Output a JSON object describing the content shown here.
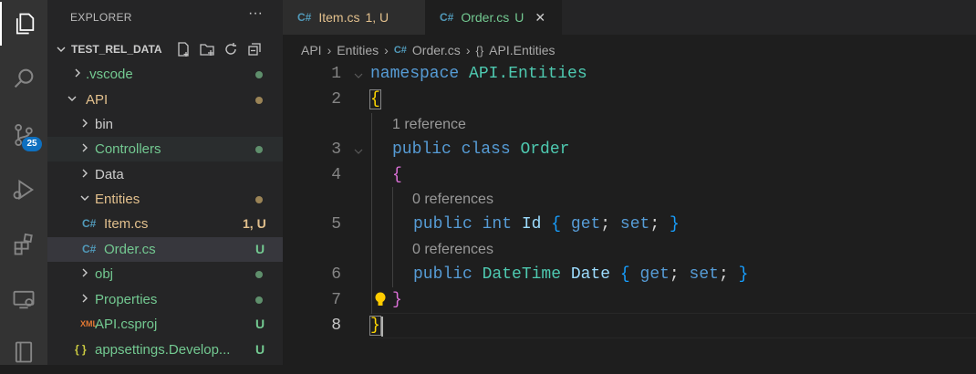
{
  "sidebar": {
    "title": "EXPLORER",
    "more": "···",
    "root": "TEST_REL_DATA",
    "items": [
      {
        "label": ".vscode"
      },
      {
        "label": "API"
      },
      {
        "label": "bin"
      },
      {
        "label": "Controllers"
      },
      {
        "label": "Data"
      },
      {
        "label": "Entities"
      },
      {
        "label": "Item.cs",
        "status": "1, U",
        "icon": "C#"
      },
      {
        "label": "Order.cs",
        "status": "U",
        "icon": "C#"
      },
      {
        "label": "obj"
      },
      {
        "label": "Properties"
      },
      {
        "label": "API.csproj",
        "status": "U",
        "icon": "XML"
      },
      {
        "label": "appsettings.Develop...",
        "status": "U",
        "icon": "{ }"
      }
    ]
  },
  "activity_bar": {
    "scm_badge": "25",
    "icons": [
      "files-icon",
      "search-icon",
      "source-control-icon",
      "run-debug-icon",
      "extensions-icon",
      "remote-explorer-icon",
      "notebook-icon"
    ]
  },
  "tabs": [
    {
      "label": "Item.cs",
      "status": "1, U",
      "icon": "C#"
    },
    {
      "label": "Order.cs",
      "status": "U",
      "icon": "C#",
      "close": "✕"
    }
  ],
  "breadcrumb": {
    "items": [
      "API",
      "Entities",
      "Order.cs",
      "API.Entities"
    ],
    "sep": "›",
    "cs_icon": "C#",
    "ns_icon": "{}"
  },
  "editor": {
    "line_numbers": [
      "1",
      "2",
      "3",
      "4",
      "5",
      "6",
      "7",
      "8"
    ],
    "lens_class": "1 reference",
    "lens_id": "0 references",
    "lens_date": "0 references",
    "tokens": {
      "namespace": "namespace",
      "ns_name": "API.Entities",
      "brace_open": "{",
      "brace_close": "}",
      "public": "public",
      "class": "class",
      "class_name": "Order",
      "int": "int",
      "id": "Id",
      "datetime": "DateTime",
      "date": "Date",
      "get": "get",
      "set": "set",
      "semi": ";"
    }
  },
  "colors": {
    "green": "#73c991",
    "yellow": "#e2c08d",
    "added": "#81b88b",
    "modified": "#e2c08d"
  }
}
